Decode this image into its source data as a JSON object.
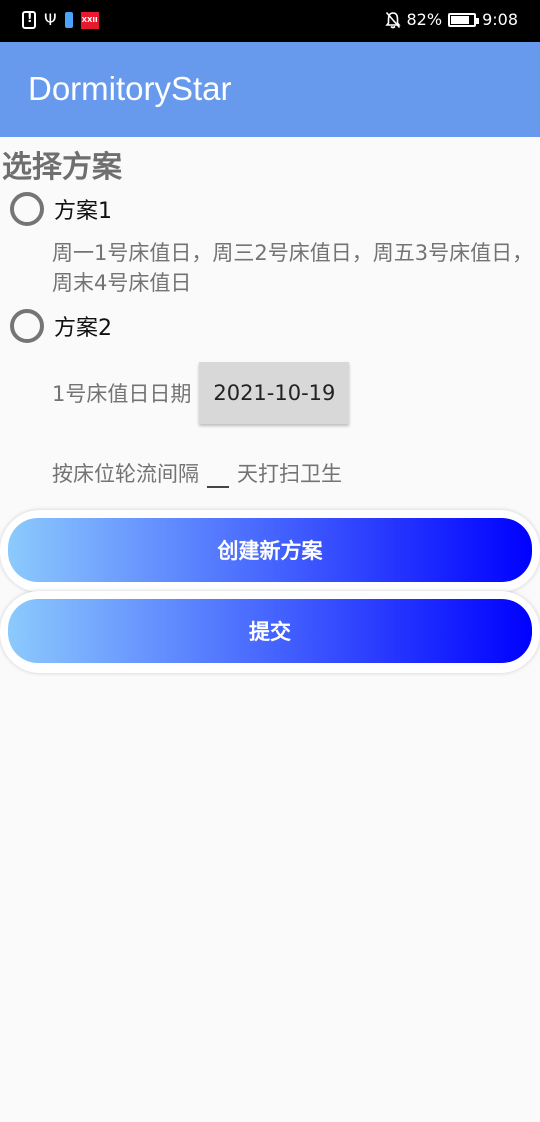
{
  "status_bar": {
    "badge_text": "XXII",
    "battery_percent": "82%",
    "battery_level": 0.82,
    "time": "9:08"
  },
  "app_bar": {
    "title": "DormitoryStar",
    "color": "#6799ec"
  },
  "form": {
    "section_title": "选择方案",
    "plan1": {
      "label": "方案1",
      "description": "周一1号床值日，周三2号床值日，周五3号床值日，周末4号床值日"
    },
    "plan2": {
      "label": "方案2",
      "date_label": "1号床值日日期",
      "date_value": "2021-10-19",
      "interval_prefix": "按床位轮流间隔",
      "interval_value": "",
      "interval_suffix": "天打扫卫生"
    }
  },
  "buttons": {
    "create": "创建新方案",
    "submit": "提交",
    "gradient_start": "#8ccafd",
    "gradient_end": "#0000ff"
  }
}
